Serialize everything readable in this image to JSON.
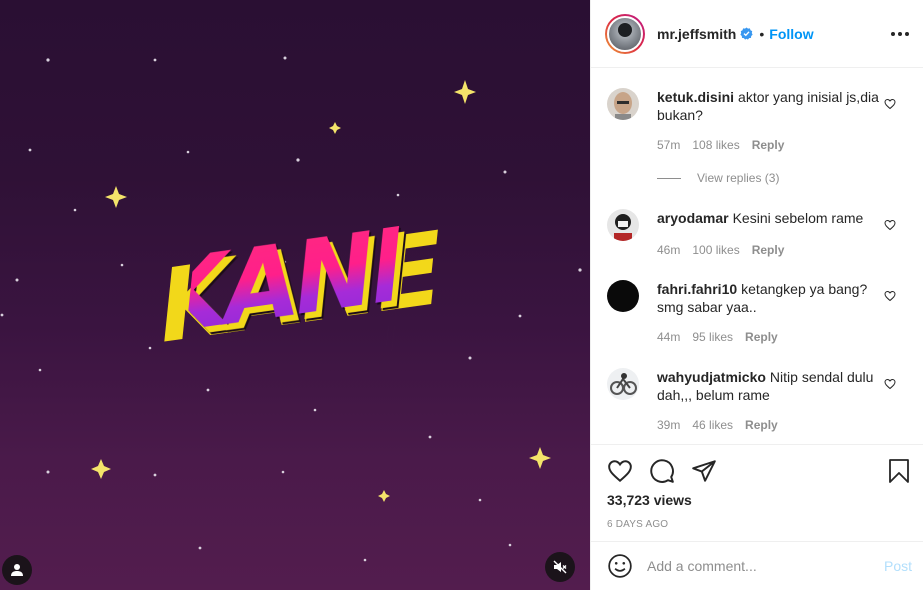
{
  "media": {
    "artwork_text": "KANE",
    "tag_icon": "person-icon",
    "mute_icon": "speaker-muted-icon"
  },
  "header": {
    "username": "mr.jeffsmith",
    "separator": "•",
    "follow_label": "Follow",
    "verified_icon": "verified-badge-icon",
    "more_icon": "more-options-icon"
  },
  "comments": [
    {
      "user": "ketuk.disini",
      "text": "aktor yang inisial js,dia bukan?",
      "time": "57m",
      "likes": "108 likes",
      "reply": "Reply"
    },
    {
      "user": "aryodamar",
      "text": "Kesini sebelom rame",
      "time": "46m",
      "likes": "100 likes",
      "reply": "Reply"
    },
    {
      "user": "fahri.fahri10",
      "text": "ketangkep ya bang? smg sabar yaa..",
      "time": "44m",
      "likes": "95 likes",
      "reply": "Reply"
    },
    {
      "user": "wahyudjatmicko",
      "text": "Nitip sendal dulu dah,,, belum rame",
      "time": "39m",
      "likes": "46 likes",
      "reply": "Reply"
    }
  ],
  "view_replies": "View replies (3)",
  "stats": {
    "views": "33,723 views",
    "date": "6 DAYS AGO"
  },
  "composer": {
    "placeholder": "Add a comment...",
    "post_label": "Post"
  },
  "colors": {
    "accent": "#0095f6",
    "muted": "#8e8e8e",
    "post_disabled": "#b2dffc"
  }
}
